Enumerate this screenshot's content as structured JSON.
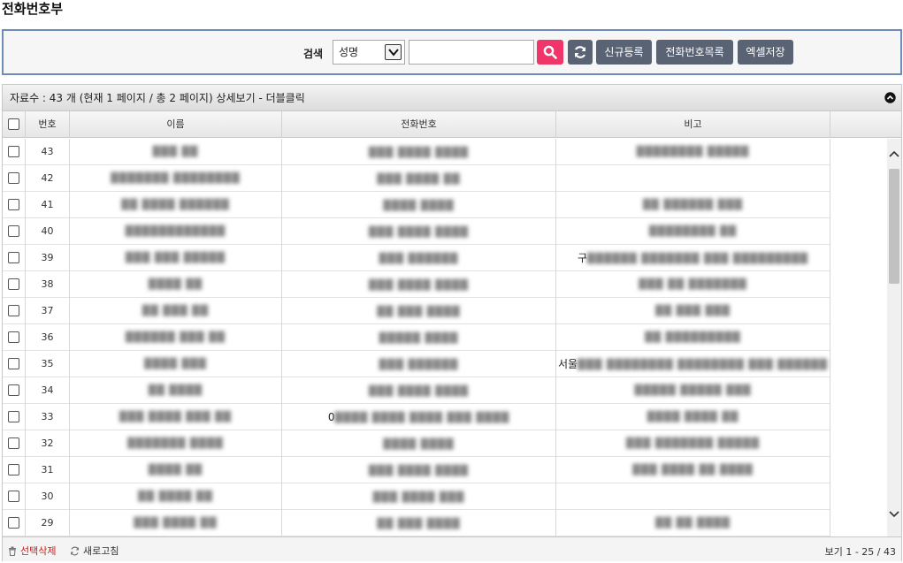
{
  "page": {
    "title": "전화번호부"
  },
  "search": {
    "label": "검색",
    "field_selected": "성명",
    "input_value": "",
    "input_placeholder": "",
    "buttons": {
      "new": "신규등록",
      "list": "전화번호목록",
      "excel": "엑셀저장"
    },
    "colors": {
      "search_button": "#f0356a",
      "gray_button": "#5a6374",
      "panel_border": "#6f8bb8"
    }
  },
  "grid": {
    "caption": "자료수 : 43 개 (현재 1 페이지 / 총 2 페이지) 상세보기 - 더블클릭",
    "columns": [
      "번호",
      "이름",
      "전화번호",
      "비고"
    ],
    "rows": [
      {
        "no": "43",
        "name": "███ ██",
        "phone": "███ ████ ████",
        "note_prefix": "",
        "note": "████████ █████"
      },
      {
        "no": "42",
        "name": "███████ ████████",
        "phone": "███ ████ ██",
        "note_prefix": "",
        "note": ""
      },
      {
        "no": "41",
        "name": "██ ████ ██████",
        "phone": "████ ████",
        "note_prefix": "",
        "note": "██ ██████ ███"
      },
      {
        "no": "40",
        "name": "████████████",
        "phone": "███ ████ ████",
        "note_prefix": "",
        "note": "████████ ██"
      },
      {
        "no": "39",
        "name": "███ ███ █████",
        "phone": "███ ██████",
        "note_prefix": "구",
        "note": "██████ ███████ ███ █████████"
      },
      {
        "no": "38",
        "name": "████ ██",
        "phone": "███ ████ ████",
        "note_prefix": "",
        "note": "███ ██ ███████"
      },
      {
        "no": "37",
        "name": "██ ███ ██",
        "phone": "██ ███ ████",
        "note_prefix": "",
        "note": "██ ███ ███"
      },
      {
        "no": "36",
        "name": "██████ ███ ██",
        "phone": "█████ ████",
        "note_prefix": "",
        "note": "██ █████████"
      },
      {
        "no": "35",
        "name": "████ ███",
        "phone": "███ ██████",
        "note_prefix": "서울",
        "note": "███ ████████ ████████ ███ ██████"
      },
      {
        "no": "34",
        "name": "██ ████",
        "phone": "███ ████ ████",
        "note_prefix": "",
        "note": "█████ █████ ███"
      },
      {
        "no": "33",
        "name": "███ ████ ███ ██",
        "phone": "████ ████ ████ ███ ████",
        "note_prefix": "0",
        "note": "████ ████ ██"
      },
      {
        "no": "32",
        "name": "███████ ████",
        "phone": "████ ████",
        "note_prefix": "",
        "note": "███ ███████ █████"
      },
      {
        "no": "31",
        "name": "████ ██",
        "phone": "███ ████ ████",
        "note_prefix": "",
        "note": "███ ████ ██ ████"
      },
      {
        "no": "30",
        "name": "██ ████ ██",
        "phone": "███ ████ ███",
        "note_prefix": "",
        "note": ""
      },
      {
        "no": "29",
        "name": "███ ████ ██",
        "phone": "██ ███ ████",
        "note_prefix": "",
        "note": "██ ██ ████"
      }
    ]
  },
  "footer": {
    "delete_label": "선택삭제",
    "refresh_label": "새로고침",
    "paging": "보기 1 - 25 / 43",
    "delete_color": "#d01818"
  }
}
